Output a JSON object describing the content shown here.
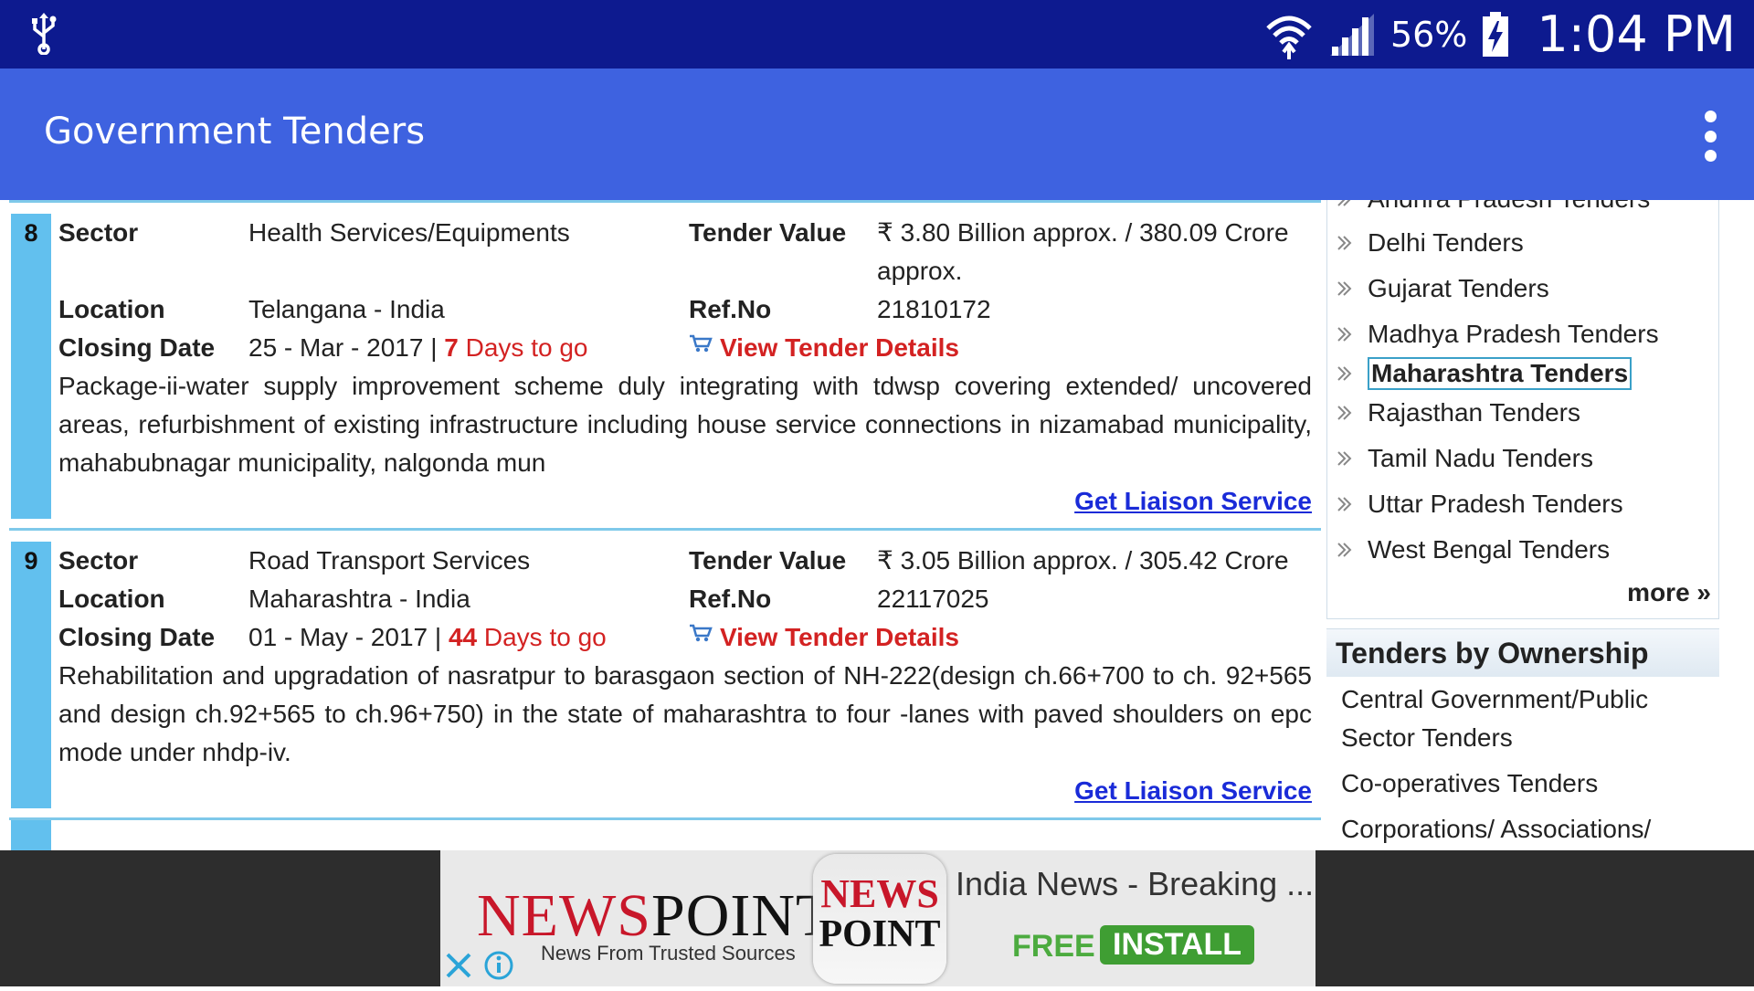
{
  "status_bar": {
    "battery": "56%",
    "time": "1:04 PM"
  },
  "app_bar": {
    "title": "Government Tenders"
  },
  "labels": {
    "sector": "Sector",
    "location": "Location",
    "closing_date": "Closing Date",
    "tender_value": "Tender Value",
    "ref_no": "Ref.No",
    "view_details": "View Tender Details",
    "liaison": "Get Liaison Service"
  },
  "tenders": [
    {
      "num": "8",
      "sector": "Health Services/Equipments",
      "location": "Telangana - India",
      "closing_date": "25 - Mar - 2017",
      "sep": "|",
      "days_num": "7",
      "days_text": "Days to go",
      "value": "₹ 3.80 Billion approx. / 380.09 Crore approx.",
      "ref": "21810172",
      "desc": "Package-ii-water supply improvement scheme duly integrating with tdwsp covering extended/ uncovered areas, refurbishment of existing infrastructure including house service connections in nizamabad municipality, mahabubnagar municipality, nalgonda mun"
    },
    {
      "num": "9",
      "sector": "Road Transport Services",
      "location": "Maharashtra - India",
      "closing_date": "01 - May - 2017",
      "sep": "|",
      "days_num": "44",
      "days_text": "Days to go",
      "value": "₹ 3.05 Billion approx. / 305.42 Crore",
      "ref": "22117025",
      "desc": "Rehabilitation and upgradation of nasratpur to barasgaon section of NH-222(design ch.66+700 to ch. 92+565 and design ch.92+565 to ch.96+750) in the state of maharashtra to four -lanes with paved shoulders on epc mode under nhdp-iv."
    }
  ],
  "sidebar": {
    "states_cut": "Andhra Pradesh Tenders",
    "states": [
      "Delhi Tenders",
      "Gujarat Tenders",
      "Madhya Pradesh Tenders",
      "Maharashtra Tenders",
      "Rajasthan Tenders",
      "Tamil Nadu Tenders",
      "Uttar Pradesh Tenders",
      "West Bengal Tenders"
    ],
    "selected": "Maharashtra Tenders",
    "more": "more »",
    "ownership_heading": "Tenders by Ownership",
    "ownership": [
      "Central Government/Public Sector Tenders",
      "Co-operatives Tenders",
      "Corporations/ Associations/"
    ]
  },
  "ad": {
    "logo_red": "NEWS",
    "logo_dark": "POINT",
    "tagline": "News From Trusted Sources",
    "icon_line1": "NEWS",
    "icon_line2": "POINT",
    "headline": "India News - Breaking ...",
    "free": "FREE",
    "install": "INSTALL"
  }
}
